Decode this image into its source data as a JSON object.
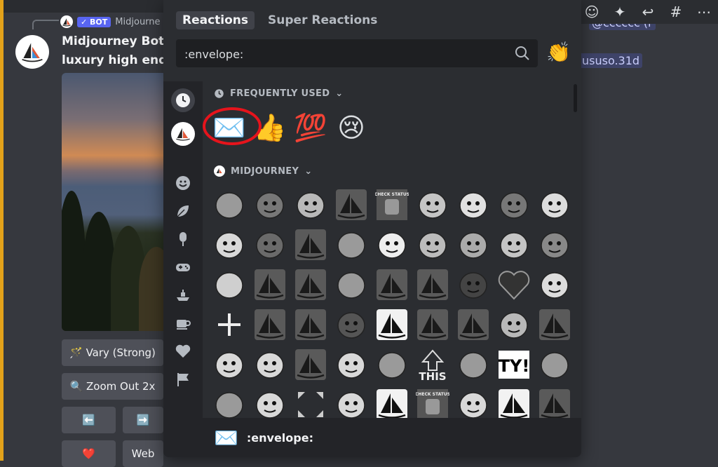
{
  "chat": {
    "reply_author": "Midjourne",
    "bot_tag": "✓ BOT",
    "author": "Midjourney Bot",
    "prompt": "luxury high end n",
    "mention_top": "@cccccc (r",
    "mention_right": "ususo.31d",
    "buttons": {
      "vary": "🪄 Vary (Strong)",
      "zoom": "🔍 Zoom Out 2x",
      "left": "⬅️",
      "right": "➡️",
      "heart": "❤️",
      "web": "Web"
    }
  },
  "picker": {
    "tabs": [
      "Reactions",
      "Super Reactions"
    ],
    "search_value": ":envelope:",
    "skin_tone": "👏",
    "sections": {
      "frequent": "FREQUENTLY USED",
      "server": "MIDJOURNEY"
    },
    "frequent": [
      "✉️",
      "👍",
      "💯",
      "😢"
    ],
    "custom_labels": [
      "CHECK STATUS",
      "THIS",
      "TY!"
    ],
    "footer_emoji": "✉️",
    "footer_name": ":envelope:"
  },
  "colors": {
    "accent": "#5865f2",
    "highlight_circle": "#e6141c"
  }
}
